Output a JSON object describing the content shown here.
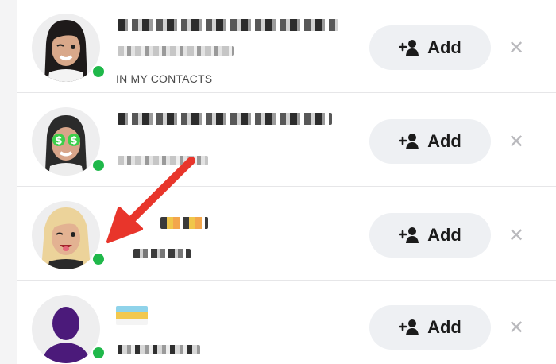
{
  "rows": [
    {
      "tag": "IN MY CONTACTS",
      "add_label": "Add"
    },
    {
      "add_label": "Add"
    },
    {
      "add_label": "Add"
    },
    {
      "add_label": "Add"
    }
  ],
  "icons": {
    "add": "add-friend-icon",
    "dismiss": "close-icon",
    "presence": "online-dot"
  },
  "colors": {
    "online": "#1fb84a",
    "annotation_arrow": "#e8352b",
    "button_bg": "#eef0f3"
  }
}
